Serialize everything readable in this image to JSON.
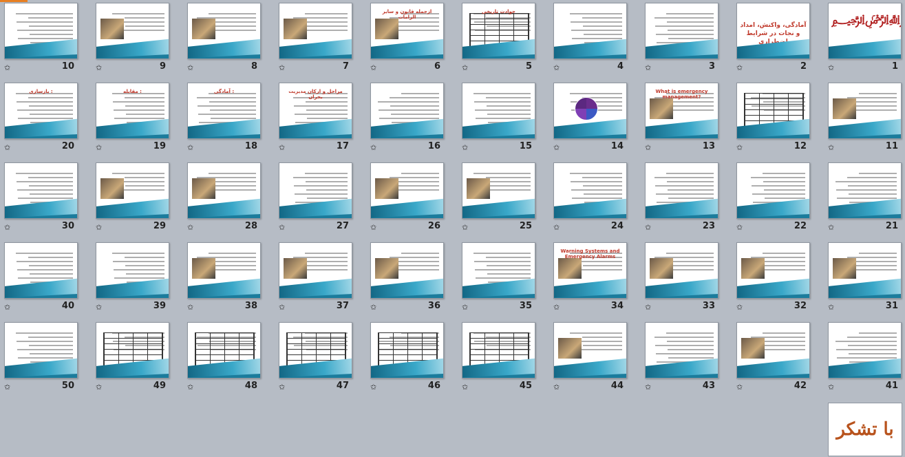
{
  "window": {
    "view": "slide-sorter"
  },
  "slides": [
    {
      "number": "1",
      "kind": "calligraphy"
    },
    {
      "number": "2",
      "kind": "title",
      "title": "آمادگی، واکنش، امداد و نجات در شرایط اضطراری"
    },
    {
      "number": "3",
      "kind": "text"
    },
    {
      "number": "4",
      "kind": "text"
    },
    {
      "number": "5",
      "kind": "table",
      "title": "حوادث تاریخی"
    },
    {
      "number": "6",
      "kind": "text-image",
      "title": "ازجمله قانون و سایر الزامات"
    },
    {
      "number": "7",
      "kind": "text-image"
    },
    {
      "number": "8",
      "kind": "text-image"
    },
    {
      "number": "9",
      "kind": "text-image"
    },
    {
      "number": "10",
      "kind": "text"
    },
    {
      "number": "11",
      "kind": "text-image"
    },
    {
      "number": "12",
      "kind": "table"
    },
    {
      "number": "13",
      "kind": "text-image",
      "title": "What is emergency management?"
    },
    {
      "number": "14",
      "kind": "pie"
    },
    {
      "number": "15",
      "kind": "text"
    },
    {
      "number": "16",
      "kind": "text"
    },
    {
      "number": "17",
      "kind": "text",
      "title": "مراحل و ارکان مدیریت بحران"
    },
    {
      "number": "18",
      "kind": "text",
      "title": "آمادگی :"
    },
    {
      "number": "19",
      "kind": "text",
      "title": "مقابله :"
    },
    {
      "number": "20",
      "kind": "text",
      "title": "بازسازی :"
    },
    {
      "number": "21",
      "kind": "text"
    },
    {
      "number": "22",
      "kind": "text"
    },
    {
      "number": "23",
      "kind": "text"
    },
    {
      "number": "24",
      "kind": "text"
    },
    {
      "number": "25",
      "kind": "text-image"
    },
    {
      "number": "26",
      "kind": "text-image"
    },
    {
      "number": "27",
      "kind": "text"
    },
    {
      "number": "28",
      "kind": "text-image"
    },
    {
      "number": "29",
      "kind": "text-image"
    },
    {
      "number": "30",
      "kind": "text"
    },
    {
      "number": "31",
      "kind": "text-image"
    },
    {
      "number": "32",
      "kind": "text-image"
    },
    {
      "number": "33",
      "kind": "text-image"
    },
    {
      "number": "34",
      "kind": "text-image",
      "title": "Warning Systems and Emergency Alarms"
    },
    {
      "number": "35",
      "kind": "text"
    },
    {
      "number": "36",
      "kind": "text-image"
    },
    {
      "number": "37",
      "kind": "text-image"
    },
    {
      "number": "38",
      "kind": "text-image"
    },
    {
      "number": "39",
      "kind": "text"
    },
    {
      "number": "40",
      "kind": "text"
    },
    {
      "number": "41",
      "kind": "text"
    },
    {
      "number": "42",
      "kind": "text-image"
    },
    {
      "number": "43",
      "kind": "text"
    },
    {
      "number": "44",
      "kind": "text-image"
    },
    {
      "number": "45",
      "kind": "table"
    },
    {
      "number": "46",
      "kind": "table"
    },
    {
      "number": "47",
      "kind": "table"
    },
    {
      "number": "48",
      "kind": "table"
    },
    {
      "number": "49",
      "kind": "table"
    },
    {
      "number": "50",
      "kind": "text"
    }
  ],
  "final_slide": {
    "text": "با تشکر"
  },
  "icons": {
    "slide_transition": "star-icon",
    "star_glyph": "✩"
  }
}
